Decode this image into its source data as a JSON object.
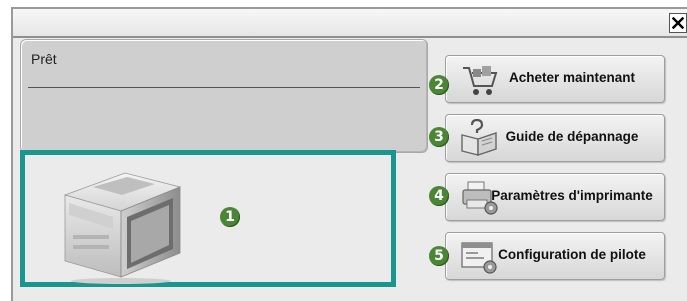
{
  "window": {
    "close_glyph": "✕"
  },
  "status": {
    "text": "Prêt"
  },
  "printer": {
    "callout": "1",
    "image": "printer-image"
  },
  "buttons": [
    {
      "label": "Acheter maintenant",
      "callout": "2",
      "icon": "shopping-cart-icon"
    },
    {
      "label": "Guide de dépannage",
      "callout": "3",
      "icon": "troubleshooting-book-icon"
    },
    {
      "label": "Paramètres d'imprimante",
      "callout": "4",
      "icon": "printer-settings-icon"
    },
    {
      "label": "Configuration de pilote",
      "callout": "5",
      "icon": "driver-configuration-icon"
    }
  ],
  "colors": {
    "callout": "#4b8536",
    "printer_frame": "#19968e",
    "panel": "#cfcfcf"
  }
}
